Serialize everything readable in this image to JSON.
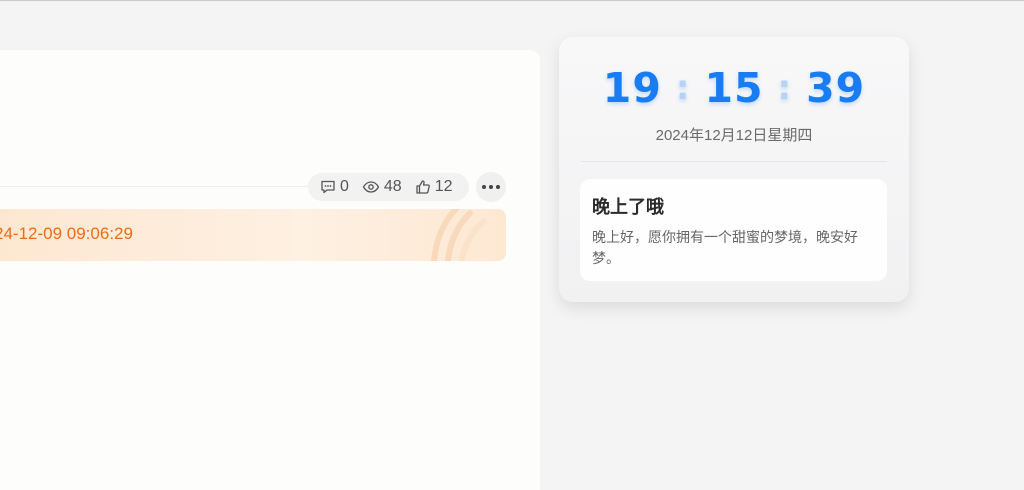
{
  "post": {
    "stats": {
      "comments": "0",
      "views": "48",
      "likes": "12"
    },
    "date_text": "24-12-09 09:06:29"
  },
  "clock_widget": {
    "hours": "19",
    "minutes": "15",
    "seconds": "39",
    "separator": ":",
    "date": "2024年12月12日星期四",
    "accent_color": "#1a7cf2"
  },
  "greeting": {
    "title": "晚上了哦",
    "message": "晚上好，愿你拥有一个甜蜜的梦境，晚安好梦。"
  },
  "icons": [
    "comment-icon",
    "eye-icon",
    "thumbs-up-icon",
    "more-icon"
  ]
}
